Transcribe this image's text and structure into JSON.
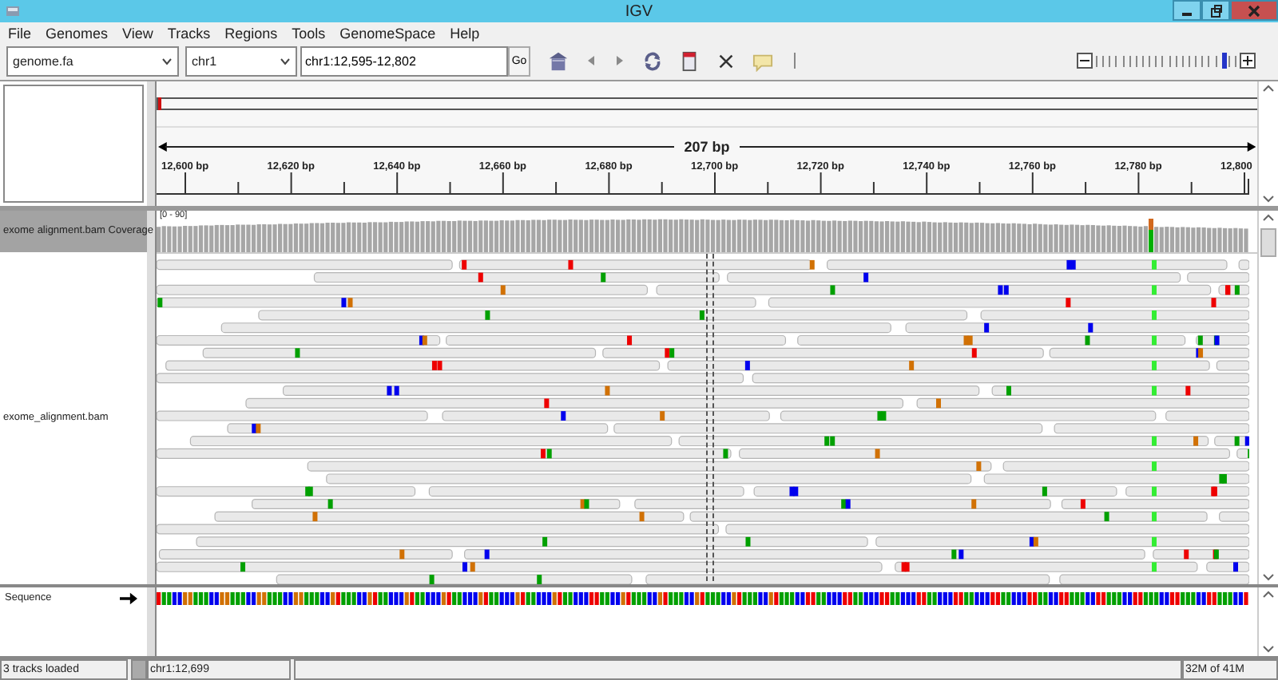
{
  "window": {
    "title": "IGV"
  },
  "menu": [
    "File",
    "Genomes",
    "View",
    "Tracks",
    "Regions",
    "Tools",
    "GenomeSpace",
    "Help"
  ],
  "toolbar": {
    "genome": "genome.fa",
    "chromosome": "chr1",
    "locus": "chr1:12,595-12,802",
    "go": "Go",
    "zoom": {
      "level": 0.92
    }
  },
  "ruler": {
    "span": "207 bp",
    "ticks": [
      "12,600 bp",
      "12,620 bp",
      "12,640 bp",
      "12,660 bp",
      "12,680 bp",
      "12,700 bp",
      "12,720 bp",
      "12,740 bp",
      "12,760 bp",
      "12,780 bp",
      "12,800"
    ]
  },
  "tracks": [
    {
      "kind": "coverage",
      "name": "exome alignment.bam Coverage",
      "range": "[0 - 90]",
      "selected": true
    },
    {
      "kind": "alignment",
      "name": "exome_alignment.bam",
      "selected": false
    },
    {
      "kind": "sequence",
      "name": "Sequence",
      "selected": false
    }
  ],
  "status_bar": {
    "message": "3 tracks loaded",
    "position": "chr1:12,699",
    "memory": "32M of 41M"
  }
}
